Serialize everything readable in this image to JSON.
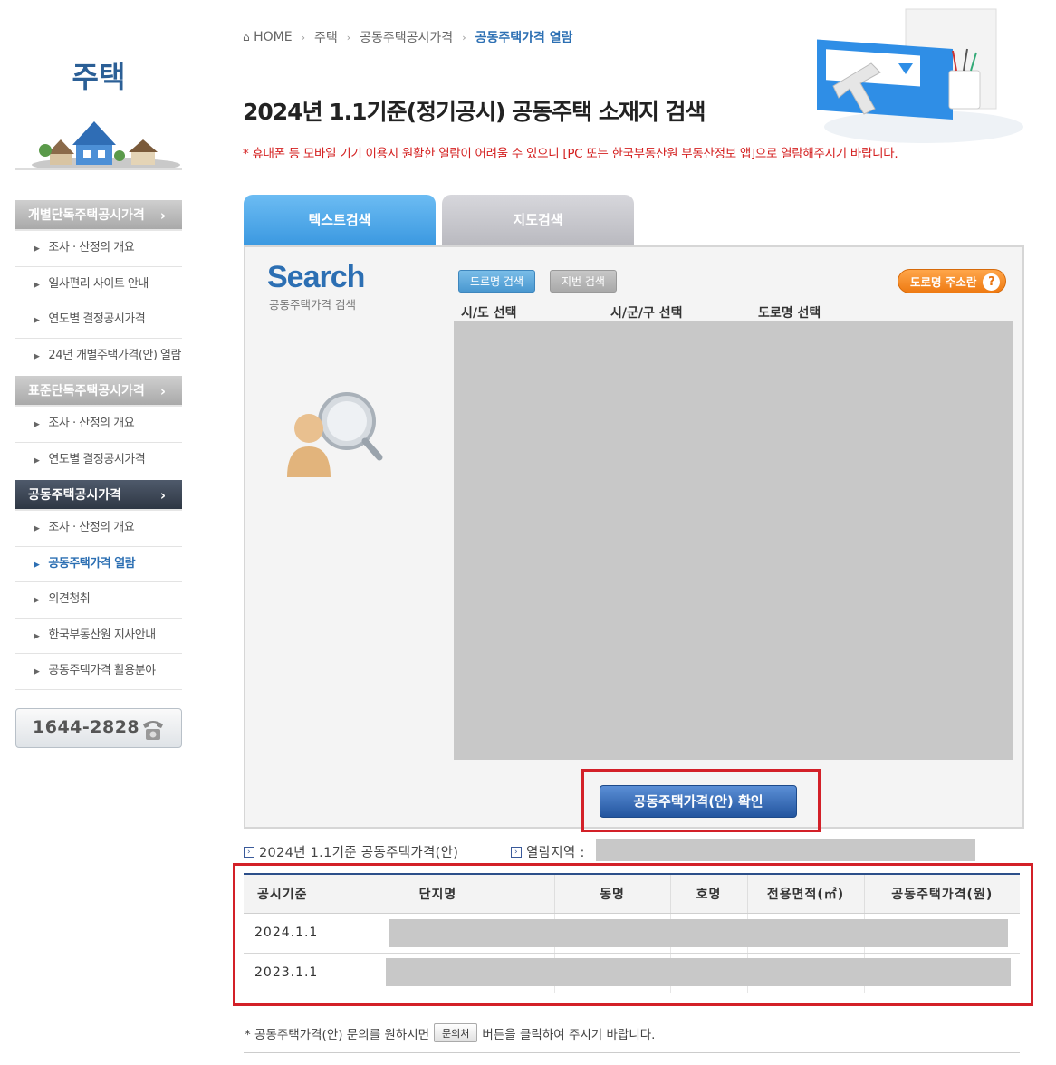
{
  "sidebar": {
    "title": "주택",
    "menus": [
      {
        "header": "개별단독주택공시가격",
        "items": [
          "조사 · 산정의 개요",
          "일사편리 사이트 안내",
          "연도별 결정공시가격",
          "24년 개별주택가격(안) 열람"
        ]
      },
      {
        "header": "표준단독주택공시가격",
        "items": [
          "조사 · 산정의 개요",
          "연도별 결정공시가격"
        ]
      },
      {
        "header": "공동주택공시가격",
        "items": [
          "조사 · 산정의 개요",
          "공동주택가격 열람",
          "의견청취",
          "한국부동산원 지사안내",
          "공동주택가격 활용분야"
        ]
      }
    ],
    "phone": "1644-2828"
  },
  "breadcrumb": {
    "home": "HOME",
    "level1": "주택",
    "level2": "공동주택공시가격",
    "current": "공동주택가격 열람"
  },
  "page_title": "2024년 1.1기준(정기공시) 공동주택 소재지 검색",
  "notice": "* 휴대폰 등 모바일 기기 이용시 원활한 열람이 어려울 수 있으니 [PC 또는 한국부동산원 부동산정보 앱]으로 열람해주시기 바랍니다.",
  "tabs": {
    "text_search": "텍스트검색",
    "map_search": "지도검색"
  },
  "search_panel": {
    "logo": "Search",
    "logo_sub": "공동주택가격 검색",
    "mode_road": "도로명 검색",
    "mode_lot": "지번 검색",
    "road_info": "도로명 주소란",
    "sido_label": "시/도 선택",
    "sigungu_label": "시/군/구 선택",
    "road_label": "도로명 선택",
    "confirm": "공동주택가격(안) 확인"
  },
  "results": {
    "info_title": "2024년 1.1기준 공동주택가격(안)",
    "region_label": "열람지역 :",
    "columns": [
      "공시기준",
      "단지명",
      "동명",
      "호명",
      "전용면적(㎡)",
      "공동주택가격(원)"
    ],
    "rows": [
      {
        "date": "2024.1.1"
      },
      {
        "date": "2023.1.1"
      }
    ]
  },
  "footer": {
    "note_pre": "* 공동주택가격(안) 문의를 원하시면",
    "inquiry_button": "문의처",
    "note_post": "버튼을 클릭하여 주시기 바랍니다."
  },
  "colors": {
    "accent": "#2c6fb3",
    "alert": "#d32028",
    "notice": "#d41f1f",
    "tab_active": "#3a98e0",
    "orange": "#ee7a12"
  }
}
